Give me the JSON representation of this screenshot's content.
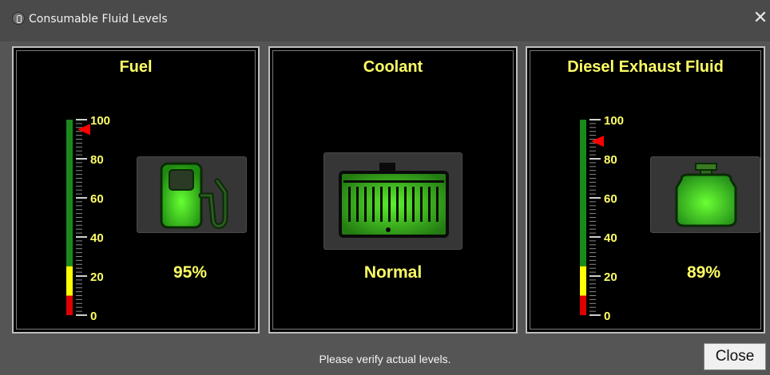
{
  "window": {
    "title": "Consumable Fluid Levels",
    "close_glyph": "✕",
    "app_icon": "app-logo-icon"
  },
  "colors": {
    "label_yellow": "#ffff66",
    "green_zone": "#1a8a1a",
    "yellow_zone": "#ffff00",
    "red_zone": "#e00000",
    "pointer": "#ff0000"
  },
  "gauge_scale": {
    "min": 0,
    "max": 100,
    "zones": {
      "red": [
        0,
        10
      ],
      "yellow": [
        10,
        25
      ],
      "green": [
        25,
        100
      ]
    },
    "tick_labels": [
      "100",
      "80",
      "60",
      "40",
      "20",
      "0"
    ]
  },
  "panels": [
    {
      "title": "Fuel",
      "icon": "fuel-pump-icon",
      "value_text": "95%",
      "level": 95
    },
    {
      "title": "Coolant",
      "icon": "radiator-icon",
      "value_text": "Normal"
    },
    {
      "title": "Diesel Exhaust Fluid",
      "icon": "def-tank-icon",
      "value_text": "89%",
      "level": 89
    }
  ],
  "footer": {
    "note": "Please verify actual levels.",
    "close_label": "Close"
  }
}
